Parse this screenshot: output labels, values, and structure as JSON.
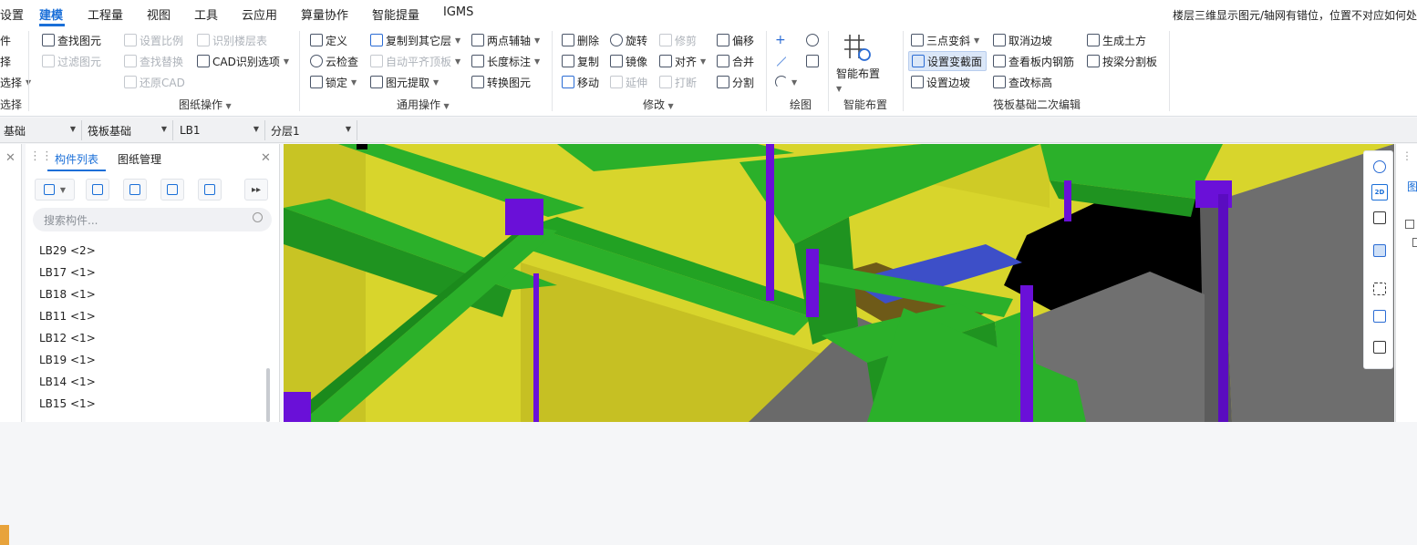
{
  "menu": {
    "items": [
      "设置",
      "建模",
      "工程量",
      "视图",
      "工具",
      "云应用",
      "算量协作",
      "智能提量",
      "IGMS"
    ],
    "active": "建模",
    "notice": "楼层三维显示图元/轴网有错位，位置不对应如何处"
  },
  "ribbon": {
    "select_group": {
      "items": [
        "件",
        "择",
        "选择"
      ],
      "label": "选择"
    },
    "drawing_ops": {
      "items": [
        "查找图元",
        "设置比例",
        "识别楼层表",
        "过滤图元",
        "查找替换",
        "CAD识别选项",
        "还原CAD"
      ],
      "label": "图纸操作"
    },
    "general_ops": {
      "items": [
        "定义",
        "复制到其它层",
        "两点辅轴",
        "云检查",
        "自动平齐顶板",
        "长度标注",
        "锁定",
        "图元提取",
        "转换图元"
      ],
      "label": "通用操作"
    },
    "modify": {
      "items": [
        "删除",
        "旋转",
        "修剪",
        "偏移",
        "复制",
        "镜像",
        "对齐",
        "合并",
        "移动",
        "延伸",
        "打断",
        "分割"
      ],
      "label": "修改"
    },
    "draw": {
      "label": "绘图"
    },
    "smart": {
      "button": "智能布置",
      "label": "智能布置"
    },
    "raft": {
      "items": [
        "三点变斜",
        "取消边坡",
        "生成土方",
        "设置变截面",
        "查看板内钢筋",
        "按梁分割板",
        "设置边坡",
        "查改标高"
      ],
      "label": "筏板基础二次编辑"
    }
  },
  "propbar": {
    "dropdowns": [
      "基础",
      "筏板基础",
      "LB1",
      "分层1"
    ]
  },
  "panel": {
    "tabs": [
      "构件列表",
      "图纸管理"
    ],
    "active_tab": "构件列表",
    "search_placeholder": "搜索构件...",
    "items": [
      "LB29 <2>",
      "LB17 <1>",
      "LB18 <1>",
      "LB11 <1>",
      "LB12 <1>",
      "LB19 <1>",
      "LB14 <1>",
      "LB15 <1>"
    ]
  },
  "rightpanel": {
    "tab": "图"
  },
  "viewtools": {
    "label_2d": "2D"
  },
  "colors": {
    "accent": "#1a6fd8",
    "slab": "#d8d52c",
    "beam": "#2bb02a",
    "column": "#6a10d8",
    "wall": "#686868",
    "pit": "#000000"
  }
}
